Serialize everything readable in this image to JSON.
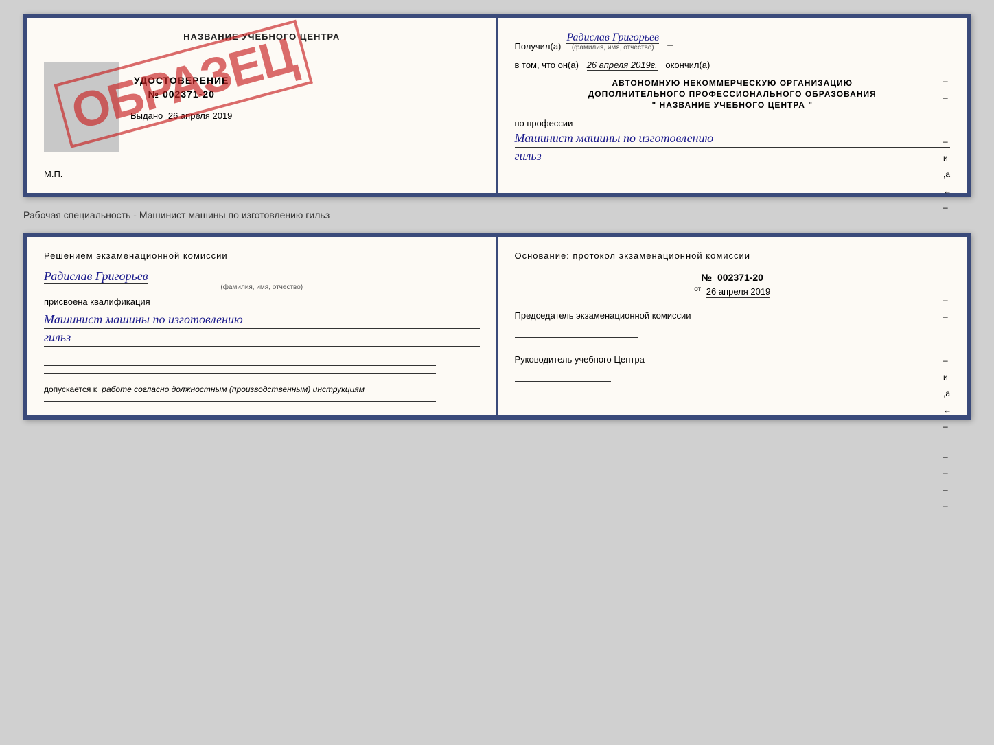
{
  "top_doc": {
    "left": {
      "title": "НАЗВАНИЕ УЧЕБНОГО ЦЕНТРА",
      "cert_label": "УДОСТОВЕРЕНИЕ",
      "cert_number": "№ 002371-20",
      "issued_label": "Выдано",
      "issued_date": "26 апреля 2019",
      "mp_label": "М.П.",
      "stamp_text": "ОБРАЗЕЦ"
    },
    "right": {
      "received_label": "Получил(а)",
      "received_name": "Радислав Григорьев",
      "fio_sub": "(фамилия, имя, отчество)",
      "vtom_label": "в том, что он(а)",
      "vtom_date": "26 апреля 2019г.",
      "finished_label": "окончил(а)",
      "org_line1": "АВТОНОМНУЮ НЕКОММЕРЧЕСКУЮ ОРГАНИЗАЦИЮ",
      "org_line2": "ДОПОЛНИТЕЛЬНОГО ПРОФЕССИОНАЛЬНОГО ОБРАЗОВАНИЯ",
      "org_quotes": "\"",
      "org_name": "НАЗВАНИЕ УЧЕБНОГО ЦЕНТРА",
      "org_quotes2": "\"",
      "profession_label": "по профессии",
      "profession_line1": "Машинист машины по изготовлению",
      "profession_line2": "гильз"
    }
  },
  "separator": {
    "text": "Рабочая специальность - Машинист машины по изготовлению гильз"
  },
  "bottom_doc": {
    "left": {
      "decision_label": "Решением экзаменационной комиссии",
      "person_name": "Радислав Григорьев",
      "fio_sub": "(фамилия, имя, отчество)",
      "assigned_label": "присвоена квалификация",
      "qual_line1": "Машинист машины по изготовлению",
      "qual_line2": "гильз",
      "allowed_label": "допускается к",
      "allowed_text": "работе согласно должностным (производственным) инструкциям"
    },
    "right": {
      "basis_label": "Основание: протокол экзаменационной комиссии",
      "number_label": "№",
      "number_value": "002371-20",
      "from_label": "от",
      "from_date": "26 апреля 2019",
      "chairman_label": "Председатель экзаменационной комиссии",
      "head_label": "Руководитель учебного Центра"
    }
  }
}
